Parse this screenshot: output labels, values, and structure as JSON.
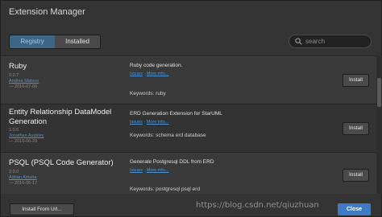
{
  "window": {
    "title": "Extension Manager"
  },
  "tabs": [
    {
      "label": "Registry",
      "active": true
    },
    {
      "label": "Installed",
      "active": false
    }
  ],
  "search": {
    "placeholder": "search",
    "value": ""
  },
  "extensions": [
    {
      "name": "Ruby",
      "version": "0.2.7",
      "author": "Andrea Matsuo",
      "date": "— 2016-07-06",
      "description": "Ruby code generation.",
      "issues_label": "Issues",
      "more_info_label": "More info...",
      "keywords": "Keywords: ruby",
      "install_label": "Install"
    },
    {
      "name": "Entity Relationship DataModel Generation",
      "version": "1.0.5",
      "author": "Jonathan Audsley",
      "date": "— 2016-06-29",
      "description": "ERD Generation Extension for StarUML",
      "issues_label": "Issues",
      "more_info_label": "More info...",
      "keywords": "Keywords: schema erd database",
      "install_label": "Install"
    },
    {
      "name": "PSQL (PSQL Code Generator)",
      "version": "2.0.0",
      "author": "Adrian Amuha",
      "date": "— 2016-06-17",
      "description": "Generate Postgresql DDL from ERD",
      "issues_label": "Issues",
      "more_info_label": "More info...",
      "keywords": "Keywords: postgresql psql erd",
      "install_label": "Install"
    }
  ],
  "footer": {
    "install_from_url_label": "Install From Url...",
    "close_label": "Close"
  },
  "watermark": "https://blog.csdn.net/qiuzhuan",
  "colors": {
    "accent": "#3d7bc5",
    "link": "#4f94d6",
    "active_tab": "#3d6684"
  }
}
